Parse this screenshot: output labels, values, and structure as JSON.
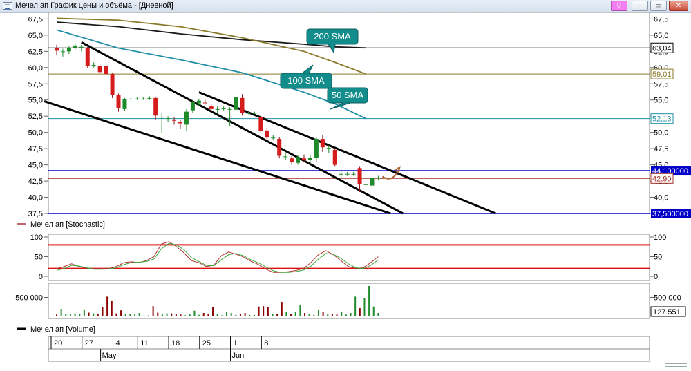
{
  "window": {
    "title": "Мечел ап График цены и объёма - [Дневной]",
    "buttons": {
      "pin": "⚲",
      "minimize": "–",
      "restore": "▭",
      "close": "✕"
    }
  },
  "chart_data": [
    {
      "type": "candlestick",
      "title": "",
      "ylim": [
        37.5,
        68.5
      ],
      "y_ticks": [
        37.5,
        40.0,
        42.5,
        45.0,
        47.5,
        50.0,
        52.5,
        55.0,
        57.5,
        60.0,
        62.5,
        65.0,
        67.5
      ],
      "y_tick_labels": [
        "37,5",
        "40,0",
        "42,5",
        "45,0",
        "47,5",
        "50,0",
        "52,5",
        "55,0",
        "57,5",
        "60,0",
        "62,5",
        "65,0",
        "67,5"
      ],
      "grid": false,
      "candles": [
        {
          "o": 63.0,
          "h": 63.5,
          "l": 62.0,
          "c": 62.6
        },
        {
          "o": 62.5,
          "h": 62.9,
          "l": 61.7,
          "c": 62.5
        },
        {
          "o": 62.5,
          "h": 63.3,
          "l": 62.1,
          "c": 63.0
        },
        {
          "o": 63.0,
          "h": 63.6,
          "l": 62.8,
          "c": 63.4
        },
        {
          "o": 63.2,
          "h": 63.5,
          "l": 62.5,
          "c": 63.2
        },
        {
          "o": 63.0,
          "h": 63.2,
          "l": 59.9,
          "c": 60.2
        },
        {
          "o": 60.4,
          "h": 60.8,
          "l": 60.0,
          "c": 60.4
        },
        {
          "o": 60.2,
          "h": 60.6,
          "l": 59.0,
          "c": 59.3
        },
        {
          "o": 60.2,
          "h": 60.7,
          "l": 58.8,
          "c": 59.0
        },
        {
          "o": 59.0,
          "h": 59.2,
          "l": 55.3,
          "c": 55.8
        },
        {
          "o": 55.8,
          "h": 56.0,
          "l": 53.2,
          "c": 53.8
        },
        {
          "o": 53.6,
          "h": 55.3,
          "l": 53.3,
          "c": 55.1
        },
        {
          "o": 55.2,
          "h": 55.5,
          "l": 54.8,
          "c": 55.2
        },
        {
          "o": 55.2,
          "h": 55.4,
          "l": 55.0,
          "c": 55.2
        },
        {
          "o": 55.2,
          "h": 55.4,
          "l": 55.0,
          "c": 55.2
        },
        {
          "o": 55.3,
          "h": 55.6,
          "l": 55.0,
          "c": 55.3
        },
        {
          "o": 55.3,
          "h": 55.5,
          "l": 52.0,
          "c": 52.6
        },
        {
          "o": 52.4,
          "h": 53.0,
          "l": 49.9,
          "c": 52.4
        },
        {
          "o": 52.2,
          "h": 52.5,
          "l": 51.6,
          "c": 52.2
        },
        {
          "o": 52.0,
          "h": 52.3,
          "l": 51.2,
          "c": 51.8
        },
        {
          "o": 51.6,
          "h": 51.9,
          "l": 50.6,
          "c": 51.4
        },
        {
          "o": 51.2,
          "h": 53.6,
          "l": 50.2,
          "c": 53.2
        },
        {
          "o": 53.4,
          "h": 55.0,
          "l": 53.0,
          "c": 54.7
        },
        {
          "o": 54.5,
          "h": 55.2,
          "l": 54.0,
          "c": 54.9
        },
        {
          "o": 54.6,
          "h": 55.1,
          "l": 54.3,
          "c": 54.5
        },
        {
          "o": 54.0,
          "h": 54.3,
          "l": 53.2,
          "c": 53.6
        },
        {
          "o": 53.5,
          "h": 54.0,
          "l": 53.0,
          "c": 53.6
        },
        {
          "o": 53.7,
          "h": 54.0,
          "l": 53.4,
          "c": 53.7
        },
        {
          "o": 53.6,
          "h": 53.9,
          "l": 51.0,
          "c": 53.6
        },
        {
          "o": 53.5,
          "h": 55.6,
          "l": 53.2,
          "c": 55.4
        },
        {
          "o": 55.3,
          "h": 55.9,
          "l": 52.6,
          "c": 53.0
        },
        {
          "o": 53.0,
          "h": 53.2,
          "l": 52.8,
          "c": 53.0
        },
        {
          "o": 53.0,
          "h": 53.2,
          "l": 52.8,
          "c": 53.0
        },
        {
          "o": 52.4,
          "h": 52.6,
          "l": 49.9,
          "c": 50.2
        },
        {
          "o": 50.3,
          "h": 50.7,
          "l": 48.9,
          "c": 49.2
        },
        {
          "o": 49.2,
          "h": 49.6,
          "l": 48.9,
          "c": 49.2
        },
        {
          "o": 49.0,
          "h": 49.3,
          "l": 46.0,
          "c": 46.4
        },
        {
          "o": 46.3,
          "h": 46.8,
          "l": 45.8,
          "c": 46.3
        },
        {
          "o": 46.0,
          "h": 46.4,
          "l": 45.0,
          "c": 45.4
        },
        {
          "o": 45.3,
          "h": 46.5,
          "l": 45.0,
          "c": 46.2
        },
        {
          "o": 46.0,
          "h": 46.6,
          "l": 45.4,
          "c": 45.7
        },
        {
          "o": 45.8,
          "h": 46.6,
          "l": 45.2,
          "c": 46.1
        },
        {
          "o": 46.1,
          "h": 49.3,
          "l": 45.5,
          "c": 49.0
        },
        {
          "o": 49.0,
          "h": 49.6,
          "l": 47.0,
          "c": 47.7
        },
        {
          "o": 47.6,
          "h": 48.0,
          "l": 46.8,
          "c": 47.6
        },
        {
          "o": 47.3,
          "h": 47.6,
          "l": 44.8,
          "c": 45.0
        },
        {
          "o": 43.6,
          "h": 44.0,
          "l": 42.8,
          "c": 43.6
        },
        {
          "o": 43.6,
          "h": 43.9,
          "l": 43.3,
          "c": 43.6
        },
        {
          "o": 43.6,
          "h": 43.9,
          "l": 43.3,
          "c": 43.6
        },
        {
          "o": 44.5,
          "h": 44.8,
          "l": 40.8,
          "c": 42.0
        },
        {
          "o": 42.0,
          "h": 42.6,
          "l": 39.3,
          "c": 42.0
        },
        {
          "o": 41.8,
          "h": 43.5,
          "l": 41.0,
          "c": 43.0
        },
        {
          "o": 43.0,
          "h": 43.3,
          "l": 42.6,
          "c": 43.0
        }
      ],
      "sma": [
        {
          "name": "200 SMA",
          "color": "#1a1a1a",
          "points": [
            [
              0,
              67.0
            ],
            [
              10,
              66.3
            ],
            [
              20,
              65.2
            ],
            [
              30,
              64.3
            ],
            [
              40,
              63.6
            ],
            [
              45,
              63.2
            ],
            [
              50,
              63.04
            ]
          ]
        },
        {
          "name": "100 SMA",
          "color": "#8a7a2a",
          "points": [
            [
              0,
              67.6
            ],
            [
              10,
              67.3
            ],
            [
              20,
              66.3
            ],
            [
              30,
              64.6
            ],
            [
              40,
              62.5
            ],
            [
              45,
              60.8
            ],
            [
              50,
              59.01
            ]
          ]
        },
        {
          "name": "50 SMA",
          "color": "#1e8fa6",
          "points": [
            [
              0,
              65.8
            ],
            [
              10,
              63.0
            ],
            [
              20,
              61.2
            ],
            [
              30,
              59.2
            ],
            [
              40,
              56.2
            ],
            [
              45,
              54.4
            ],
            [
              50,
              52.13
            ]
          ]
        }
      ],
      "horizontal_levels": [
        {
          "value": 63.04,
          "label": "63,04",
          "color": "#000000"
        },
        {
          "value": 59.01,
          "label": "59,01",
          "color": "#8a7a2a"
        },
        {
          "value": 52.13,
          "label": "52,13",
          "color": "#1e8fa6"
        },
        {
          "value": 44.1,
          "label": "44,100000",
          "color": "#0000c8",
          "badge": true
        },
        {
          "value": 42.9,
          "label": "42,90",
          "color": "#a0302a"
        },
        {
          "value": 37.5,
          "label": "37,500000",
          "color": "#0000c8",
          "badge": true
        }
      ],
      "trendlines": [
        {
          "from": [
            -2,
            54.8
          ],
          "to": [
            54,
            37.5
          ]
        },
        {
          "from": [
            4,
            63.9
          ],
          "to": [
            56,
            37.5
          ]
        },
        {
          "from": [
            23,
            56.2
          ],
          "to": [
            71,
            37.5
          ]
        }
      ],
      "annotations": [
        {
          "text": "200 SMA",
          "anchor": "63,04"
        },
        {
          "text": "100 SMA",
          "anchor": "59,01"
        },
        {
          "text": "50 SMA",
          "anchor": "52,13"
        }
      ]
    },
    {
      "type": "line",
      "title": "Мечел ап [Stochastic]",
      "ylim": [
        0,
        100
      ],
      "y_ticks": [
        0,
        50,
        100
      ],
      "y_tick_labels": [
        "0",
        "50",
        "100"
      ],
      "levels": [
        80,
        20
      ],
      "series": [
        {
          "color": "#b03030",
          "values": [
            20,
            25,
            32,
            25,
            20,
            20,
            20,
            20,
            25,
            35,
            37,
            35,
            40,
            50,
            82,
            88,
            76,
            60,
            40,
            35,
            25,
            28,
            52,
            62,
            56,
            49,
            38,
            30,
            18,
            10,
            10,
            12,
            15,
            20,
            35,
            55,
            65,
            55,
            40,
            25,
            20,
            22,
            35,
            50
          ]
        },
        {
          "color": "#3aa83a",
          "values": [
            15,
            20,
            28,
            26,
            22,
            18,
            18,
            19,
            22,
            30,
            35,
            36,
            38,
            44,
            70,
            84,
            80,
            68,
            48,
            38,
            28,
            27,
            42,
            55,
            58,
            52,
            42,
            34,
            24,
            14,
            10,
            10,
            12,
            16,
            26,
            44,
            58,
            56,
            46,
            32,
            22,
            20,
            28,
            42
          ]
        }
      ]
    },
    {
      "type": "bar",
      "title": "Мечел ап [Volume]",
      "ylim": [
        0,
        800000
      ],
      "y_tick_labels": [
        "500 000"
      ],
      "last_value_label": "127 551",
      "values": [
        50000,
        200000,
        60000,
        60000,
        80000,
        60000,
        170000,
        100000,
        80000,
        70000,
        240000,
        520000,
        420000,
        80000,
        160000,
        60000,
        70000,
        50000,
        90000,
        20000,
        30000,
        270000,
        100000,
        50000,
        80000,
        80000,
        60000,
        50000,
        30000,
        50000,
        150000,
        40000,
        90000,
        60000,
        240000,
        60000,
        30000,
        120000,
        90000,
        40000,
        60000,
        90000,
        40000,
        40000,
        260000,
        270000,
        240000,
        60000,
        70000,
        380000,
        110000,
        60000,
        120000,
        290000,
        90000,
        60000,
        40000,
        180000,
        120000,
        70000,
        60000,
        50000,
        120000,
        50000,
        90000,
        520000,
        220000,
        480000,
        800000,
        260000,
        90000
      ],
      "colors": "up-green/down-red"
    }
  ],
  "x_axis": {
    "day_ticks": [
      {
        "label": "20",
        "index": 0
      },
      {
        "label": "27",
        "index": 5
      },
      {
        "label": "4",
        "index": 10
      },
      {
        "label": "11",
        "index": 14
      },
      {
        "label": "18",
        "index": 19
      },
      {
        "label": "25",
        "index": 24
      },
      {
        "label": "1",
        "index": 29
      },
      {
        "label": "8",
        "index": 34
      }
    ],
    "month_ticks": [
      {
        "label": "May",
        "index": 8
      },
      {
        "label": "Jun",
        "index": 29
      }
    ]
  }
}
